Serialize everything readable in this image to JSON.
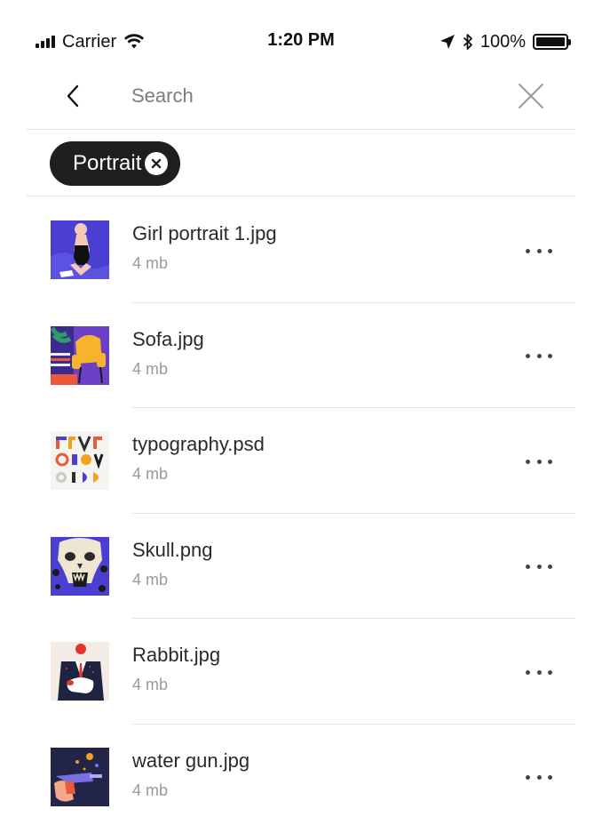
{
  "status_bar": {
    "carrier": "Carrier",
    "time": "1:20 PM",
    "battery_percent": "100%"
  },
  "search": {
    "placeholder": "Search",
    "value": ""
  },
  "filters": [
    {
      "label": "Portrait"
    }
  ],
  "files": [
    {
      "name": "Girl portrait 1.jpg",
      "size": "4 mb",
      "thumb_icon": "girl-portrait-thumbnail"
    },
    {
      "name": "Sofa.jpg",
      "size": "4 mb",
      "thumb_icon": "sofa-thumbnail"
    },
    {
      "name": "typography.psd",
      "size": "4 mb",
      "thumb_icon": "typography-thumbnail"
    },
    {
      "name": "Skull.png",
      "size": "4 mb",
      "thumb_icon": "skull-thumbnail"
    },
    {
      "name": "Rabbit.jpg",
      "size": "4 mb",
      "thumb_icon": "rabbit-thumbnail"
    },
    {
      "name": "water gun.jpg",
      "size": "4 mb",
      "thumb_icon": "water-gun-thumbnail"
    }
  ],
  "colors": {
    "chip_background": "#1f1f1f",
    "divider": "#e2e2e2",
    "secondary_text": "#9a9a9a",
    "placeholder_text": "#7b7b85",
    "accent_purple": "#4a3fd0"
  }
}
